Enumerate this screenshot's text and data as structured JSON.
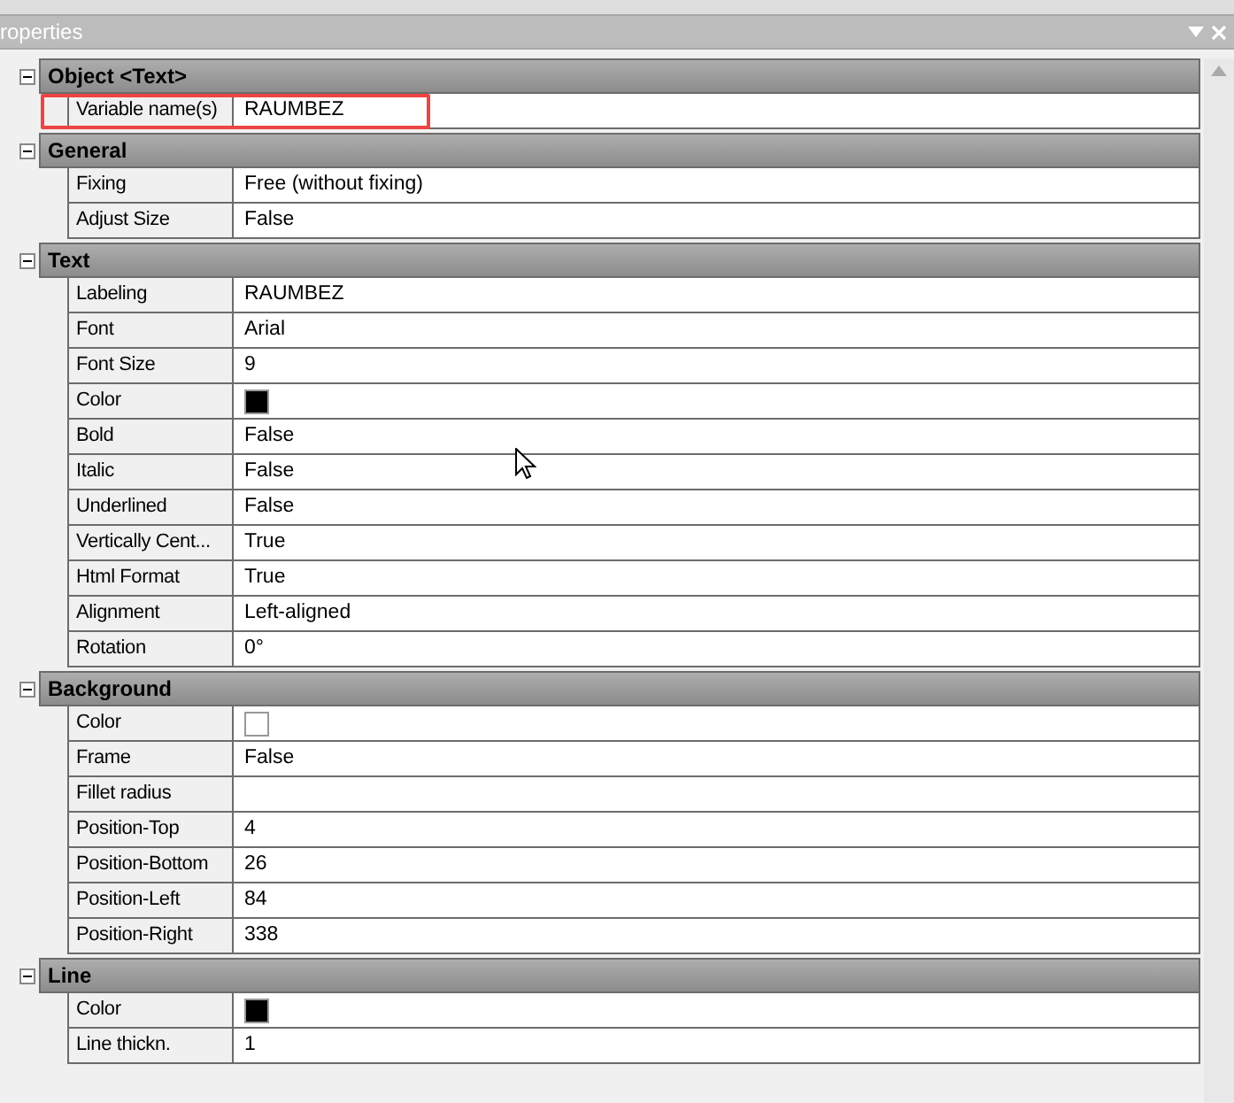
{
  "panel": {
    "title": "roperties"
  },
  "categories": [
    {
      "title": "Object <Text>",
      "expanded": true,
      "items": [
        {
          "label": "Variable name(s)",
          "value": "RAUMBEZ",
          "highlighted": true
        }
      ]
    },
    {
      "title": "General",
      "expanded": true,
      "items": [
        {
          "label": "Fixing",
          "value": "Free (without fixing)"
        },
        {
          "label": "Adjust Size",
          "value": "False"
        }
      ]
    },
    {
      "title": "Text",
      "expanded": true,
      "items": [
        {
          "label": "Labeling",
          "value": "RAUMBEZ"
        },
        {
          "label": "Font",
          "value": "Arial"
        },
        {
          "label": "Font Size",
          "value": "9"
        },
        {
          "label": "Color",
          "kind": "color",
          "color": "#000000"
        },
        {
          "label": "Bold",
          "value": "False"
        },
        {
          "label": "Italic",
          "value": "False"
        },
        {
          "label": "Underlined",
          "value": "False"
        },
        {
          "label": "Vertically Cent...",
          "value": "True"
        },
        {
          "label": "Html Format",
          "value": "True"
        },
        {
          "label": "Alignment",
          "value": "Left-aligned"
        },
        {
          "label": "Rotation",
          "value": "0°"
        }
      ]
    },
    {
      "title": "Background",
      "expanded": true,
      "items": [
        {
          "label": "Color",
          "kind": "color",
          "color": "#ffffff"
        },
        {
          "label": "Frame",
          "value": "False"
        },
        {
          "label": "Fillet radius"
        },
        {
          "label": "Position-Top",
          "value": "4"
        },
        {
          "label": "Position-Bottom",
          "value": "26"
        },
        {
          "label": "Position-Left",
          "value": "84"
        },
        {
          "label": "Position-Right",
          "value": "338"
        }
      ]
    },
    {
      "title": "Line",
      "expanded": true,
      "items": [
        {
          "label": "Color",
          "kind": "color",
          "color": "#000000"
        },
        {
          "label": "Line thickn.",
          "value": "1"
        }
      ]
    }
  ]
}
